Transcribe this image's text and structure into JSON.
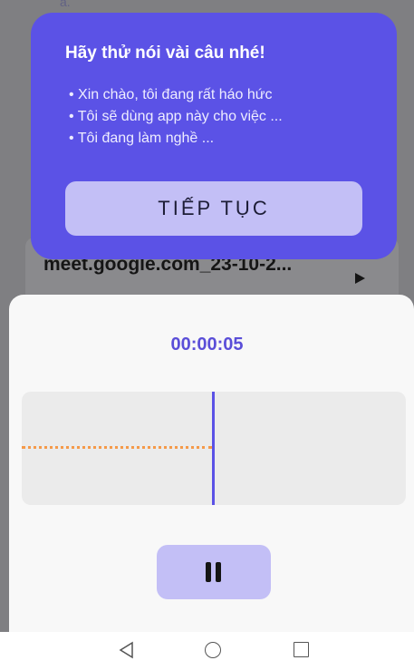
{
  "background": {
    "file_name": "meet.google.com_23-10-2...",
    "partial_text": "ẩ.",
    "play_icon": "play-icon"
  },
  "prompt": {
    "title": "Hãy thử nói vài câu nhé!",
    "examples": [
      "Xin chào, tôi đang rất háo hức",
      "Tôi sẽ dùng app này cho việc ...",
      "Tôi đang làm nghề ..."
    ],
    "continue_label": "TIẾP TỤC"
  },
  "recorder": {
    "timer": "00:00:05",
    "pause_icon": "pause-icon"
  },
  "nav_bar": {
    "back_icon": "back-triangle-icon",
    "home_icon": "home-circle-icon",
    "recent_icon": "recent-apps-square-icon"
  },
  "colors": {
    "accent": "#5b52e6",
    "accent_light": "#c3bff6",
    "wave_color": "#f59a4a",
    "timer_color": "#5a4ed8"
  }
}
